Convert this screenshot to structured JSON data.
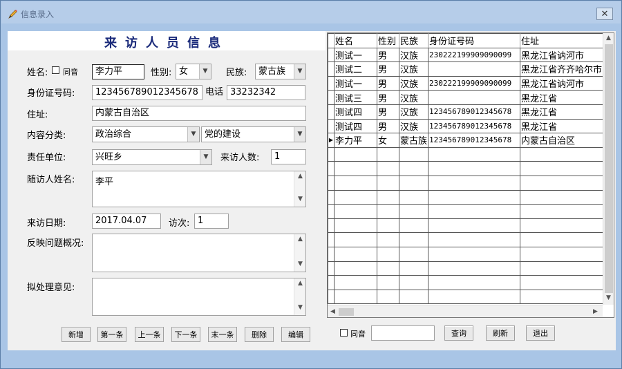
{
  "window": {
    "title": "信息录入",
    "close_glyph": "✕"
  },
  "form": {
    "title": "来访人员信息",
    "name_label": "姓名:",
    "homophone_label": "同音",
    "name_value": "李力平",
    "gender_label": "性别:",
    "gender_value": "女",
    "ethnicity_label": "民族:",
    "ethnicity_value": "蒙古族",
    "id_label": "身份证号码:",
    "id_value": "123456789012345678",
    "phone_label": "电话",
    "phone_value": "33232342",
    "address_label": "住址:",
    "address_value": "内蒙古自治区",
    "category_label": "内容分类:",
    "category_value": "政治综合",
    "subcategory_value": "党的建设",
    "unit_label": "责任单位:",
    "unit_value": "兴旺乡",
    "visitor_count_label": "来访人数:",
    "visitor_count_value": "1",
    "companion_label": "随访人姓名:",
    "companion_value": "李平",
    "date_label": "来访日期:",
    "date_value": "2017.04.07",
    "visit_no_label": "访次:",
    "visit_no_value": "1",
    "issue_label": "反映问题概况:",
    "issue_value": "",
    "opinion_label": "拟处理意见:",
    "opinion_value": ""
  },
  "buttons": {
    "add": "新增",
    "first": "第一条",
    "prev": "上一条",
    "next": "下一条",
    "last": "末一条",
    "delete": "删除",
    "edit": "编辑",
    "search_homophone": "同音",
    "query": "查询",
    "refresh": "刷新",
    "exit": "退出"
  },
  "search": {
    "value": ""
  },
  "grid": {
    "columns": [
      "姓名",
      "性别",
      "民族",
      "身份证号码",
      "住址"
    ],
    "current_row_marker": "▶",
    "rows": [
      [
        "测试一",
        "男",
        "汉族",
        "230222199909090099",
        "黑龙江省讷河市"
      ],
      [
        "测试二",
        "男",
        "汉族",
        "",
        "黑龙江省齐齐哈尔市"
      ],
      [
        "测试一",
        "男",
        "汉族",
        "230222199909090099",
        "黑龙江省讷河市"
      ],
      [
        "测试三",
        "男",
        "汉族",
        "",
        "黑龙江省"
      ],
      [
        "测试四",
        "男",
        "汉族",
        "123456789012345678",
        "黑龙江省"
      ],
      [
        "测试四",
        "男",
        "汉族",
        "123456789012345678",
        "黑龙江省"
      ],
      [
        "李力平",
        "女",
        "蒙古族",
        "123456789012345678",
        "内蒙古自治区"
      ]
    ],
    "empty_rows": 11,
    "current_row": 7
  }
}
